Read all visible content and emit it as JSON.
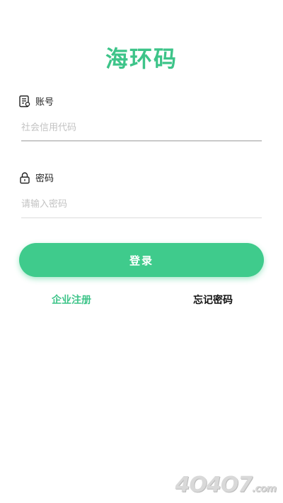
{
  "app": {
    "title": "海环码"
  },
  "account": {
    "label": "账号",
    "placeholder": "社会信用代码",
    "value": ""
  },
  "password": {
    "label": "密码",
    "placeholder": "请输入密码",
    "value": ""
  },
  "actions": {
    "login_label": "登录",
    "register_label": "企业注册",
    "forgot_label": "忘记密码"
  },
  "watermark": {
    "text": "4O4O7",
    "suffix": ".com"
  },
  "colors": {
    "accent": "#3fcb8c",
    "title": "#3dc489",
    "link_register": "#3dc489",
    "link_forgot": "#111111"
  },
  "icons": {
    "account": "id-card-icon",
    "password": "lock-icon"
  }
}
